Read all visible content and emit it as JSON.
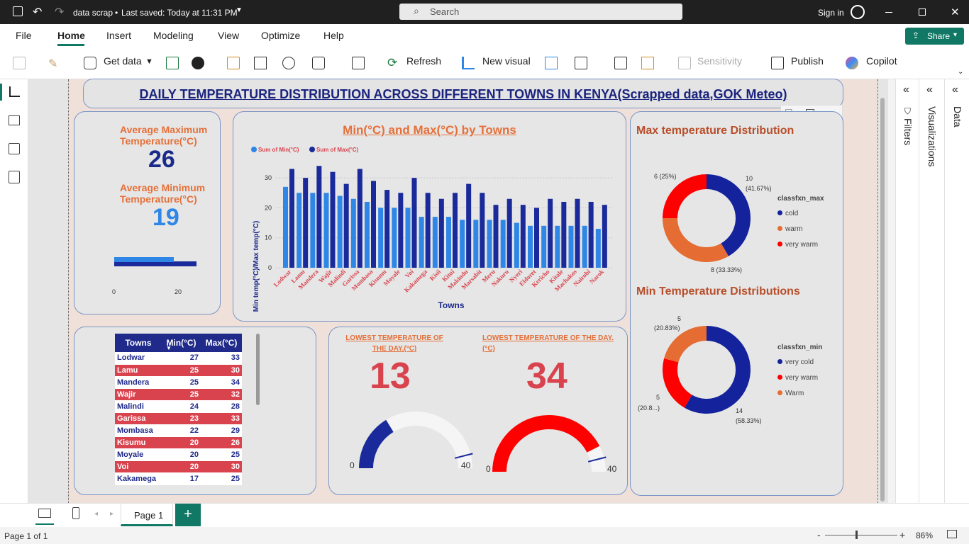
{
  "titlebar": {
    "title": "data scrap",
    "saved": "Last saved: Today at 11:31 PM",
    "search_placeholder": "Search",
    "sign_in": "Sign in"
  },
  "menu": [
    "File",
    "Home",
    "Insert",
    "Modeling",
    "View",
    "Optimize",
    "Help"
  ],
  "share": "Share",
  "ribbon": {
    "get_data": "Get data",
    "refresh": "Refresh",
    "new_visual": "New visual",
    "sensitivity": "Sensitivity",
    "publish": "Publish",
    "copilot": "Copilot"
  },
  "panels": {
    "filters": "Filters",
    "visualizations": "Visualizations",
    "data": "Data"
  },
  "report": {
    "title": "DAILY TEMPERATURE DISTRIBUTION ACROSS DIFFERENT TOWNS IN KENYA(Scrapped data,GOK Meteo)",
    "kpi": {
      "avg_max_label": "Average Maximum Temperature(°C)",
      "avg_max_value": "26",
      "avg_min_label": "Average Minimum Temperature(°C)",
      "avg_min_value": "19",
      "bar_min_tick": "0",
      "bar_max_tick": "20",
      "bar_min_fraction": 0.42,
      "bar_max_fraction": 0.58
    },
    "gauges": {
      "lowest_label": "LOWEST TEMPERATURE OF THE DAY.(°C)",
      "lowest_value": "13",
      "highest_label": "LOWEST TEMPERATURE OF THE DAY.(°C)",
      "highest_value": "34",
      "min": "0",
      "max": "40",
      "color_low": "#1a2a9a",
      "color_high": "#ff0000"
    },
    "table": {
      "headers": [
        "Towns",
        "Min(°C)",
        "Max(°C)"
      ],
      "rows": [
        [
          "Lodwar",
          "27",
          "33"
        ],
        [
          "Lamu",
          "25",
          "30"
        ],
        [
          "Mandera",
          "25",
          "34"
        ],
        [
          "Wajir",
          "25",
          "32"
        ],
        [
          "Malindi",
          "24",
          "28"
        ],
        [
          "Garissa",
          "23",
          "33"
        ],
        [
          "Mombasa",
          "22",
          "29"
        ],
        [
          "Kisumu",
          "20",
          "26"
        ],
        [
          "Moyale",
          "20",
          "25"
        ],
        [
          "Voi",
          "20",
          "30"
        ],
        [
          "Kakamega",
          "17",
          "25"
        ]
      ]
    },
    "donut_max": {
      "title": "Max temperature Distribution",
      "legend_title": "classfxn_max",
      "legend": [
        {
          "name": "cold",
          "color": "#14239b"
        },
        {
          "name": "warm",
          "color": "#e56c32"
        },
        {
          "name": "very warm",
          "color": "#ff0000"
        }
      ],
      "labels": [
        "10",
        "(41.67%)",
        "8 (33.33%)",
        "6 (25%)"
      ]
    },
    "donut_min": {
      "title": "Min Temperature Distributions",
      "legend_title": "classfxn_min",
      "legend": [
        {
          "name": "very cold",
          "color": "#14239b"
        },
        {
          "name": "very warm",
          "color": "#ff0000"
        },
        {
          "name": "Warm",
          "color": "#e56c32"
        }
      ],
      "labels": [
        "14",
        "(58.33%)",
        "5",
        "(20.8...)",
        "5",
        "(20.83%)"
      ]
    }
  },
  "chart_data": [
    {
      "type": "bar",
      "title": "Min(°C) and Max(°C) by Towns",
      "xlabel": "Towns",
      "ylabel": "Min temp(°C)/Max temp(°C)",
      "ylim": [
        0,
        35
      ],
      "legend": "top-left",
      "categories": [
        "Lodwar",
        "Lamu",
        "Mandera",
        "Wajir",
        "Malindi",
        "Garissa",
        "Mombasa",
        "Kisumu",
        "Moyale",
        "Voi",
        "Kakamega",
        "Kisii",
        "Kitui",
        "Makindu",
        "Marsabit",
        "Meru",
        "Nakuru",
        "Nyeri",
        "Eldoret",
        "Kericho",
        "Kitale",
        "Machakos",
        "Nairobi",
        "Narok"
      ],
      "series": [
        {
          "name": "Sum of Min(°C)",
          "color": "#2e86e6",
          "values": [
            27,
            25,
            25,
            25,
            24,
            23,
            22,
            20,
            20,
            20,
            17,
            17,
            17,
            16,
            16,
            16,
            16,
            15,
            14,
            14,
            14,
            14,
            14,
            13
          ]
        },
        {
          "name": "Sum of Max(°C)",
          "color": "#1a2a9a",
          "values": [
            33,
            30,
            34,
            32,
            28,
            33,
            29,
            26,
            25,
            30,
            25,
            23,
            25,
            28,
            25,
            21,
            23,
            21,
            20,
            23,
            22,
            23,
            22,
            21
          ]
        }
      ],
      "yticks": [
        "0",
        "10",
        "20",
        "30"
      ]
    },
    {
      "type": "pie",
      "title": "Max temperature Distribution",
      "categories": [
        "cold",
        "warm",
        "very warm"
      ],
      "values": [
        10,
        8,
        6
      ]
    },
    {
      "type": "pie",
      "title": "Min Temperature Distributions",
      "categories": [
        "very cold",
        "very warm",
        "Warm"
      ],
      "values": [
        14,
        5,
        5
      ]
    }
  ],
  "tabs": {
    "page": "Page 1"
  },
  "status": {
    "page_of": "Page 1 of 1",
    "zoom": "86%"
  }
}
